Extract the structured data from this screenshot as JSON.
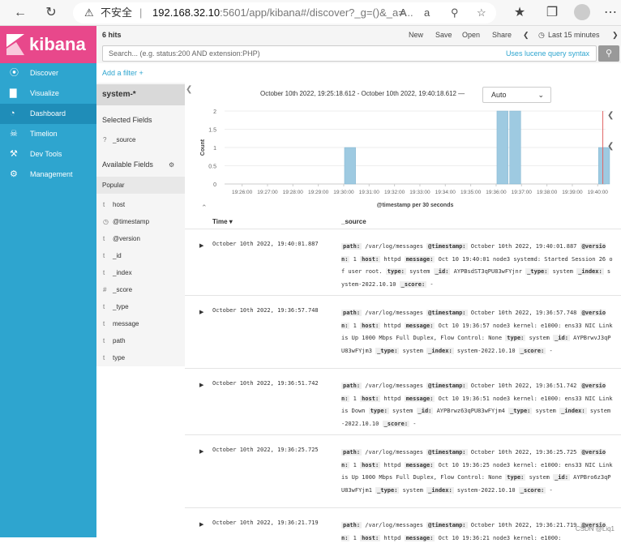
{
  "browser": {
    "insecure_label": "不安全",
    "url_host": "192.168.32.10",
    "url_rest": ":5601/app/kibana#/discover?_g=()&_a=..."
  },
  "sidebar": {
    "brand": "kibana",
    "items": [
      {
        "label": "Discover",
        "icon": "compass-icon"
      },
      {
        "label": "Visualize",
        "icon": "bar-chart-icon"
      },
      {
        "label": "Dashboard",
        "icon": "dashboard-icon"
      },
      {
        "label": "Timelion",
        "icon": "timelion-icon"
      },
      {
        "label": "Dev Tools",
        "icon": "wrench-icon"
      },
      {
        "label": "Management",
        "icon": "gear-icon"
      }
    ],
    "active_index": 2,
    "colors": {
      "sidebar": "#2ea5cf",
      "logo": "#e8488b"
    }
  },
  "topbar": {
    "hits": "6 hits",
    "new": "New",
    "save": "Save",
    "open": "Open",
    "share": "Share",
    "time": "Last 15 minutes"
  },
  "search": {
    "placeholder": "Search... (e.g. status:200 AND extension:PHP)",
    "lucene": "Uses lucene query syntax"
  },
  "filter": {
    "add_label": "Add a filter +"
  },
  "fields": {
    "index": "system-*",
    "selected_heading": "Selected Fields",
    "selected": [
      {
        "type": "?",
        "name": "_source"
      }
    ],
    "available_heading": "Available Fields",
    "popular_label": "Popular",
    "available": [
      {
        "type": "t",
        "name": "host"
      },
      {
        "type": "clock",
        "name": "@timestamp"
      },
      {
        "type": "t",
        "name": "@version"
      },
      {
        "type": "t",
        "name": "_id"
      },
      {
        "type": "t",
        "name": "_index"
      },
      {
        "type": "#",
        "name": "_score"
      },
      {
        "type": "t",
        "name": "_type"
      },
      {
        "type": "t",
        "name": "message"
      },
      {
        "type": "t",
        "name": "path"
      },
      {
        "type": "t",
        "name": "type"
      }
    ]
  },
  "chart_header": {
    "range": "October 10th 2022, 19:25:18.612 - October 10th 2022, 19:40:18.612 —",
    "interval": "Auto"
  },
  "chart_data": {
    "type": "bar",
    "ylabel": "Count",
    "xlabel": "@timestamp per 30 seconds",
    "ylim": [
      0,
      2
    ],
    "yticks": [
      "0",
      "0.5",
      "1",
      "1.5",
      "2"
    ],
    "x_ticks": [
      "19:26:00",
      "19:27:00",
      "19:28:00",
      "19:29:00",
      "19:30:00",
      "19:31:00",
      "19:32:00",
      "19:33:00",
      "19:34:00",
      "19:35:00",
      "19:36:00",
      "19:37:00",
      "19:38:00",
      "19:39:00",
      "19:40:00"
    ],
    "x_min_minutes": 25.31,
    "x_max_minutes": 40.31,
    "buckets": [
      {
        "start": "19:30:00",
        "value": 1
      },
      {
        "start": "19:36:00",
        "value": 2
      },
      {
        "start": "19:36:30",
        "value": 2
      },
      {
        "start": "19:40:00",
        "value": 1
      }
    ],
    "bar_color": "#9ecae1",
    "now_marker_color": "#e06666"
  },
  "table": {
    "col_time": "Time",
    "col_source": "_source",
    "rows": [
      {
        "time": "October 10th 2022, 19:40:01.887",
        "src": [
          [
            "path:",
            "/var/log/messages"
          ],
          [
            "@timestamp:",
            "October 10th 2022, 19:40:01.887"
          ],
          [
            "@version:",
            "1"
          ],
          [
            "host:",
            "httpd"
          ],
          [
            "message:",
            "Oct 10 19:40:01 node3 systemd: Started Session 26 of user root."
          ],
          [
            "type:",
            "system"
          ],
          [
            "_id:",
            "AYPBsdST3qPU83wFYjnr"
          ],
          [
            "_type:",
            "system"
          ],
          [
            "_index:",
            "system-2022.10.10"
          ],
          [
            "_score:",
            "-"
          ]
        ]
      },
      {
        "time": "October 10th 2022, 19:36:57.748",
        "src": [
          [
            "path:",
            "/var/log/messages"
          ],
          [
            "@timestamp:",
            "October 10th 2022, 19:36:57.748"
          ],
          [
            "@version:",
            "1"
          ],
          [
            "host:",
            "httpd"
          ],
          [
            "message:",
            "Oct 10 19:36:57 node3 kernel: e1000: ens33 NIC Link is Up 1000 Mbps Full Duplex, Flow Control: None"
          ],
          [
            "type:",
            "system"
          ],
          [
            "_id:",
            "AYPBrwvJ3qPU83wFYjm3"
          ],
          [
            "_type:",
            "system"
          ],
          [
            "_index:",
            "system-2022.10.10"
          ],
          [
            "_score:",
            "-"
          ]
        ]
      },
      {
        "time": "October 10th 2022, 19:36:51.742",
        "src": [
          [
            "path:",
            "/var/log/messages"
          ],
          [
            "@timestamp:",
            "October 10th 2022, 19:36:51.742"
          ],
          [
            "@version:",
            "1"
          ],
          [
            "host:",
            "httpd"
          ],
          [
            "message:",
            "Oct 10 19:36:51 node3 kernel: e1000: ens33 NIC Link is Down"
          ],
          [
            "type:",
            "system"
          ],
          [
            "_id:",
            "AYPBrwz63qPU83wFYjm4"
          ],
          [
            "_type:",
            "system"
          ],
          [
            "_index:",
            "system-2022.10.10"
          ],
          [
            "_score:",
            "-"
          ]
        ]
      },
      {
        "time": "October 10th 2022, 19:36:25.725",
        "src": [
          [
            "path:",
            "/var/log/messages"
          ],
          [
            "@timestamp:",
            "October 10th 2022, 19:36:25.725"
          ],
          [
            "@version:",
            "1"
          ],
          [
            "host:",
            "httpd"
          ],
          [
            "message:",
            "Oct 10 19:36:25 node3 kernel: e1000: ens33 NIC Link is Up 1000 Mbps Full Duplex, Flow Control: None"
          ],
          [
            "type:",
            "system"
          ],
          [
            "_id:",
            "AYPBro6z3qPU83wFYjm1"
          ],
          [
            "_type:",
            "system"
          ],
          [
            "_index:",
            "system-2022.10.10"
          ],
          [
            "_score:",
            "-"
          ]
        ]
      },
      {
        "time": "October 10th 2022, 19:36:21.719",
        "src": [
          [
            "path:",
            "/var/log/messages"
          ],
          [
            "@timestamp:",
            "October 10th 2022, 19:36:21.719"
          ],
          [
            "@version:",
            "1"
          ],
          [
            "host:",
            "httpd"
          ],
          [
            "message:",
            "Oct 10 19:36:21 node3 kernel: e1000:"
          ]
        ]
      }
    ]
  },
  "watermark": "CSDN @Liq1"
}
